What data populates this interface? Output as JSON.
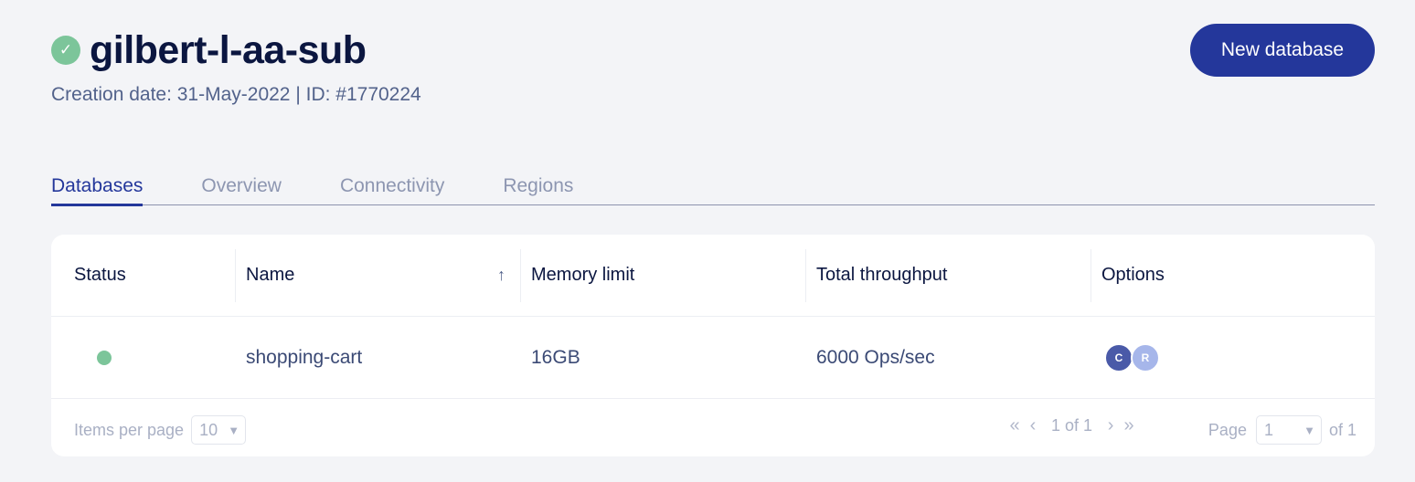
{
  "header": {
    "title": "gilbert-l-aa-sub",
    "status_icon": "check-icon",
    "meta": "Creation date: 31-May-2022 | ID: #1770224",
    "new_button": "New database"
  },
  "tabs": [
    {
      "label": "Databases",
      "active": true
    },
    {
      "label": "Overview",
      "active": false
    },
    {
      "label": "Connectivity",
      "active": false
    },
    {
      "label": "Regions",
      "active": false
    }
  ],
  "table": {
    "columns": [
      "Status",
      "Name",
      "Memory limit",
      "Total throughput",
      "Options"
    ],
    "sort_icon": "↑",
    "rows": [
      {
        "status": "active",
        "name": "shopping-cart",
        "memory": "16GB",
        "throughput": "6000 Ops/sec",
        "options": [
          "C",
          "R"
        ]
      }
    ]
  },
  "footer": {
    "items_per_page_label": "Items per page",
    "items_per_page_value": "10",
    "range": "1 of 1",
    "page_label": "Page",
    "page_value": "1",
    "page_total": "of 1"
  },
  "colors": {
    "primary": "#24379b",
    "success": "#7cc59a",
    "background": "#f3f4f7"
  }
}
